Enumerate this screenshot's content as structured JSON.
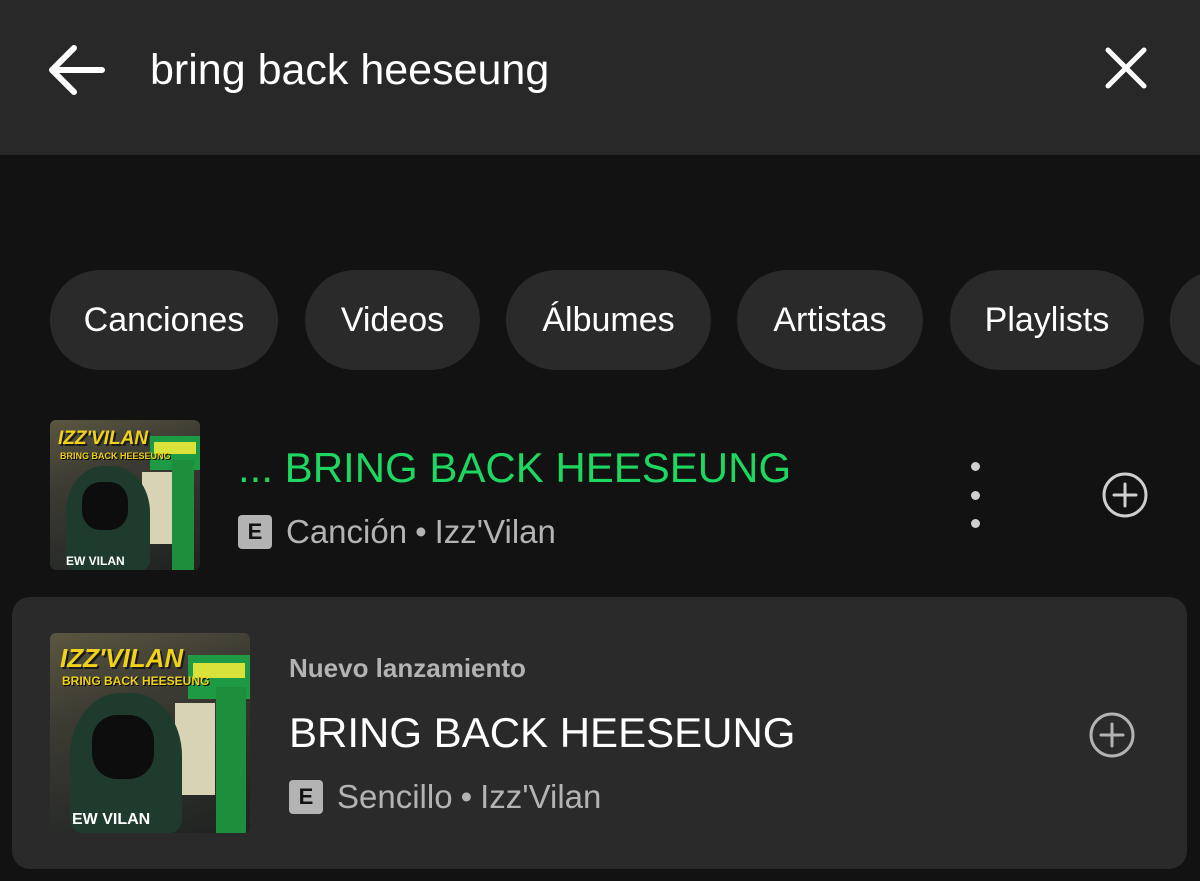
{
  "search": {
    "query": "bring back heeseung",
    "back_icon": "arrow-left-icon",
    "clear_icon": "close-icon"
  },
  "filters": [
    "Canciones",
    "Videos",
    "Álbumes",
    "Artistas",
    "Playlists"
  ],
  "results": {
    "top": {
      "title": "... BRING BACK HEESEUNG",
      "explicit_badge": "E",
      "type": "Canción",
      "separator": "•",
      "artist": "Izz'Vilan",
      "title_color": "#1ed760"
    },
    "release": {
      "label": "Nuevo lanzamiento",
      "title": "BRING BACK HEESEUNG",
      "explicit_badge": "E",
      "type": "Sencillo",
      "separator": "•",
      "artist": "Izz'Vilan"
    }
  },
  "artwork": {
    "logo": "IZZ'VILAN",
    "subtitle": "BRING BACK HEESEUNG",
    "shirt_text": "EW VILAN"
  },
  "colors": {
    "background": "#121212",
    "topbar": "#282828",
    "chip": "#2a2a2a",
    "accent": "#1ed760",
    "muted": "#b3b3b3"
  }
}
